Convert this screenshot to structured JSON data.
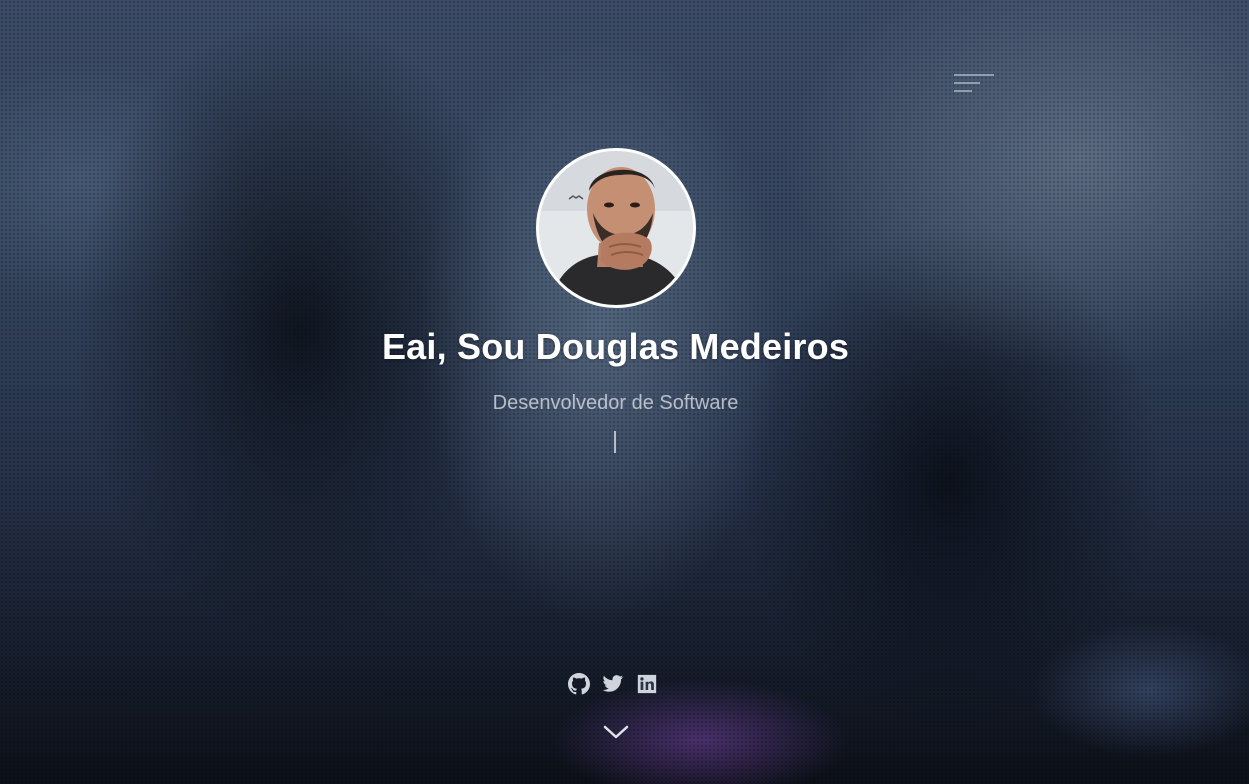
{
  "hero": {
    "title": "Eai, Sou Douglas Medeiros",
    "subtitle": "Desenvolvedor de Software"
  },
  "nav": {
    "menu_icon": "hamburger-menu-icon"
  },
  "social": [
    {
      "icon": "github-icon"
    },
    {
      "icon": "twitter-icon"
    },
    {
      "icon": "linkedin-icon"
    }
  ],
  "scroll": {
    "icon": "chevron-down-icon"
  },
  "colors": {
    "text_primary": "#ffffff",
    "text_secondary": "#d7dce4",
    "icon": "#d0d4dc"
  }
}
